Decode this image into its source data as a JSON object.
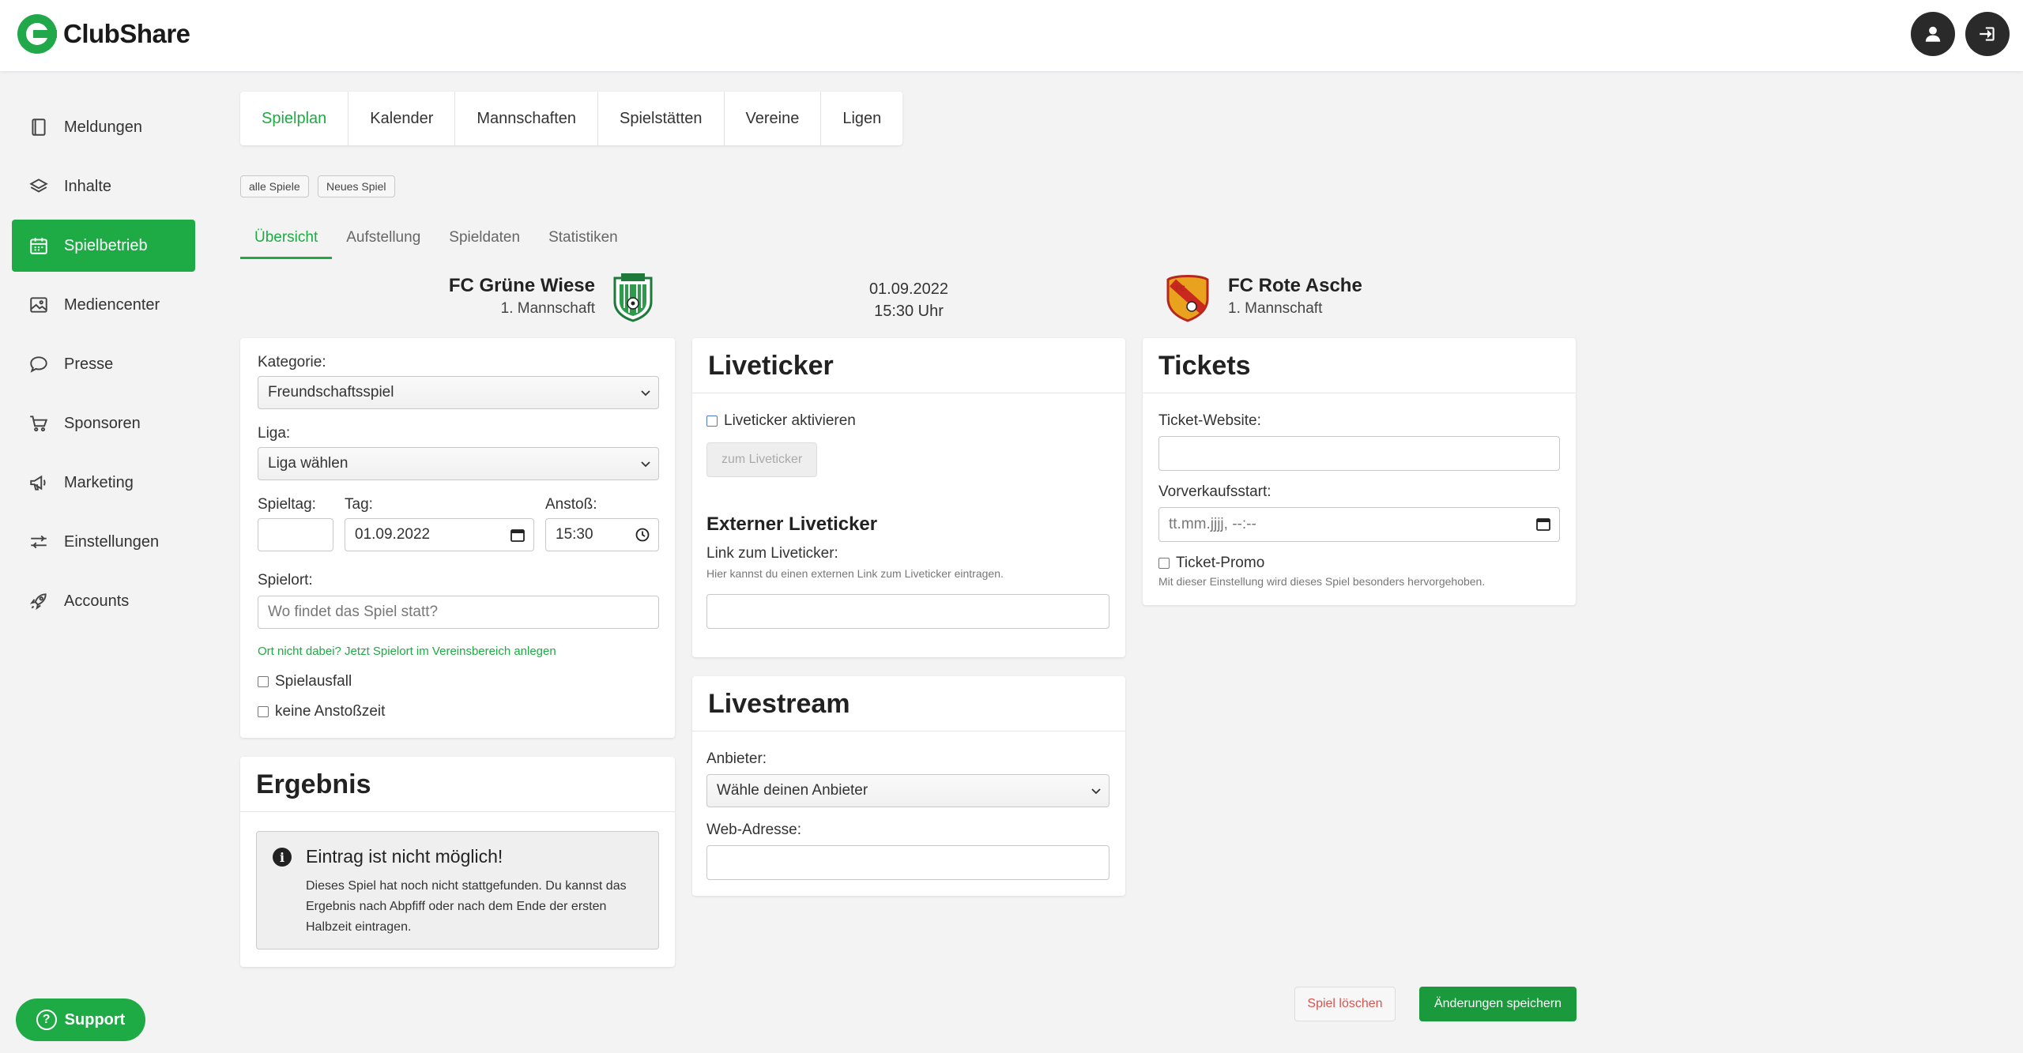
{
  "app": {
    "name": "ClubShare"
  },
  "sidebar": {
    "items": [
      {
        "label": "Meldungen",
        "icon": "book-icon"
      },
      {
        "label": "Inhalte",
        "icon": "layers-icon"
      },
      {
        "label": "Spielbetrieb",
        "icon": "calendar-icon",
        "active": true
      },
      {
        "label": "Mediencenter",
        "icon": "image-icon"
      },
      {
        "label": "Presse",
        "icon": "chat-icon"
      },
      {
        "label": "Sponsoren",
        "icon": "cart-icon"
      },
      {
        "label": "Marketing",
        "icon": "megaphone-icon"
      },
      {
        "label": "Einstellungen",
        "icon": "sliders-icon"
      },
      {
        "label": "Accounts",
        "icon": "rocket-icon"
      }
    ],
    "support_label": "Support"
  },
  "main_tabs": [
    "Spielplan",
    "Kalender",
    "Mannschaften",
    "Spielstätten",
    "Vereine",
    "Ligen"
  ],
  "pills": {
    "all": "alle Spiele",
    "new": "Neues Spiel"
  },
  "sub_tabs": [
    "Übersicht",
    "Aufstellung",
    "Spieldaten",
    "Statistiken"
  ],
  "match": {
    "home": {
      "name": "FC Grüne Wiese",
      "team": "1. Mannschaft"
    },
    "away": {
      "name": "FC Rote Asche",
      "team": "1. Mannschaft"
    },
    "date": "01.09.2022",
    "time": "15:30 Uhr"
  },
  "details": {
    "kategorie_label": "Kategorie:",
    "kategorie_value": "Freundschaftsspiel",
    "liga_label": "Liga:",
    "liga_value": "Liga wählen",
    "spieltag_label": "Spieltag:",
    "spieltag_value": "",
    "tag_label": "Tag:",
    "tag_value": "01.09.2022",
    "anstoss_label": "Anstoß:",
    "anstoss_value": "15:30",
    "spielort_label": "Spielort:",
    "spielort_placeholder": "Wo findet das Spiel statt?",
    "spielort_link": "Ort nicht dabei? Jetzt Spielort im Vereinsbereich anlegen",
    "spielausfall": "Spielausfall",
    "keine_anstosszeit": "keine Anstoßzeit"
  },
  "ergebnis": {
    "title": "Ergebnis",
    "info_title": "Eintrag ist nicht möglich!",
    "info_text": "Dieses Spiel hat noch nicht stattgefunden. Du kannst das Ergebnis nach Abpfiff oder nach dem Ende der ersten Halbzeit eintragen."
  },
  "liveticker": {
    "title": "Liveticker",
    "activate": "Liveticker aktivieren",
    "button": "zum Liveticker",
    "extern_title": "Externer Liveticker",
    "link_label": "Link zum Liveticker:",
    "link_hint": "Hier kannst du einen externen Link zum Liveticker eintragen.",
    "link_value": ""
  },
  "livestream": {
    "title": "Livestream",
    "anbieter_label": "Anbieter:",
    "anbieter_value": "Wähle deinen Anbieter",
    "web_label": "Web-Adresse:",
    "web_value": ""
  },
  "tickets": {
    "title": "Tickets",
    "website_label": "Ticket-Website:",
    "website_value": "",
    "vvk_label": "Vorverkaufsstart:",
    "vvk_placeholder": "tt.mm.jjjj, --:--",
    "promo_label": "Ticket-Promo",
    "promo_hint": "Mit dieser Einstellung wird dieses Spiel besonders hervorgehoben."
  },
  "actions": {
    "delete": "Spiel löschen",
    "save": "Änderungen speichern"
  },
  "colors": {
    "accent": "#1eaa44",
    "danger": "#d9534f",
    "dark": "#2a2a2a"
  }
}
